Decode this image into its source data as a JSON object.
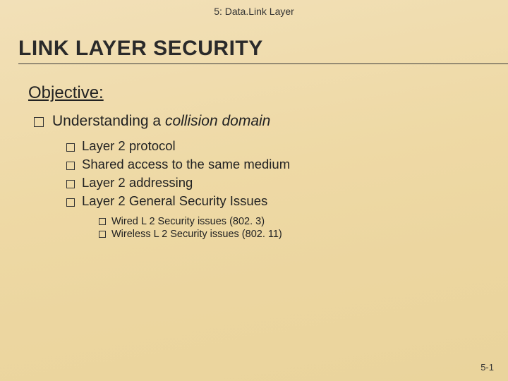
{
  "header": {
    "chapter_label": "5: Data.Link Layer"
  },
  "title": "LINK LAYER SECURITY",
  "objective_label": "Objective:",
  "lvl1": {
    "prefix": "Understanding a ",
    "italic": "collision domain"
  },
  "lvl2": [
    "Layer 2 protocol",
    "Shared access to the same medium",
    "Layer 2 addressing",
    "Layer 2 General Security Issues"
  ],
  "lvl3": [
    "Wired L 2 Security issues (802. 3)",
    "Wireless L 2 Security issues (802. 11)"
  ],
  "page_number": "5-1"
}
